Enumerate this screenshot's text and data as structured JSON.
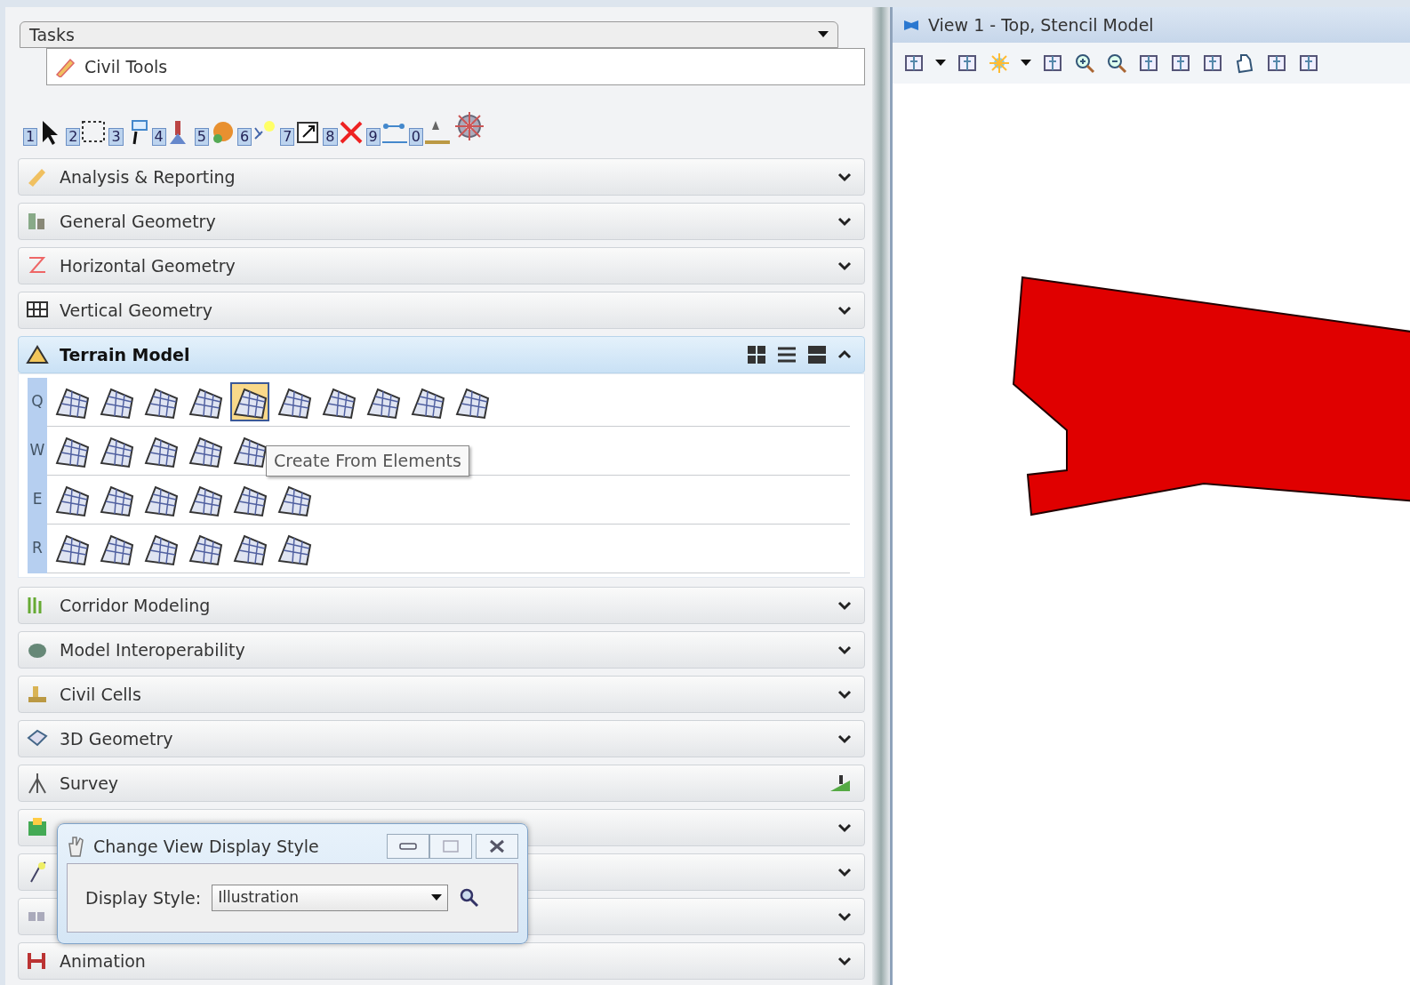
{
  "tasks": {
    "title": "Tasks",
    "current": "Civil Tools"
  },
  "toolbar": {
    "keys": [
      "1",
      "2",
      "3",
      "4",
      "5",
      "6",
      "7",
      "8",
      "9",
      "0"
    ]
  },
  "sections": [
    {
      "label": "Analysis & Reporting",
      "kind": "collapsible",
      "expanded": false
    },
    {
      "label": "General Geometry",
      "kind": "collapsible",
      "expanded": false
    },
    {
      "label": "Horizontal Geometry",
      "kind": "collapsible",
      "expanded": false
    },
    {
      "label": "Vertical Geometry",
      "kind": "collapsible",
      "expanded": false
    },
    {
      "label": "Terrain Model",
      "kind": "collapsible",
      "expanded": true,
      "rows": [
        {
          "key": "Q",
          "tools": [
            {
              "selected": false
            },
            {
              "selected": false
            },
            {
              "selected": false
            },
            {
              "selected": false
            },
            {
              "selected": true
            },
            {
              "selected": false
            },
            {
              "selected": false
            },
            {
              "selected": false
            },
            {
              "selected": false
            },
            {
              "selected": false
            }
          ]
        },
        {
          "key": "W",
          "tools": [
            {
              "selected": false
            },
            {
              "selected": false
            },
            {
              "selected": false
            },
            {
              "selected": false
            },
            {
              "selected": false
            }
          ]
        },
        {
          "key": "E",
          "tools": [
            {
              "selected": false
            },
            {
              "selected": false
            },
            {
              "selected": false
            },
            {
              "selected": false
            },
            {
              "selected": false
            },
            {
              "selected": false
            }
          ]
        },
        {
          "key": "R",
          "tools": [
            {
              "selected": false
            },
            {
              "selected": false
            },
            {
              "selected": false
            },
            {
              "selected": false
            },
            {
              "selected": false
            },
            {
              "selected": false
            }
          ]
        }
      ],
      "tooltip": "Create From Elements"
    },
    {
      "label": "Corridor Modeling",
      "kind": "collapsible",
      "expanded": false
    },
    {
      "label": "Model Interoperability",
      "kind": "collapsible",
      "expanded": false
    },
    {
      "label": "Civil Cells",
      "kind": "collapsible",
      "expanded": false
    },
    {
      "label": "3D Geometry",
      "kind": "collapsible",
      "expanded": false
    },
    {
      "label": "Survey",
      "kind": "launcher",
      "expanded": false
    },
    {
      "kind": "collapsible",
      "expanded": false
    },
    {
      "kind": "collapsible",
      "expanded": false
    },
    {
      "kind": "collapsible",
      "expanded": false
    },
    {
      "label": "Animation",
      "kind": "collapsible",
      "expanded": false
    }
  ],
  "dialog": {
    "title": "Change View Display Style",
    "field_label": "Display Style:",
    "value": "Illustration"
  },
  "view": {
    "title": "View 1 - Top, Stencil Model"
  }
}
